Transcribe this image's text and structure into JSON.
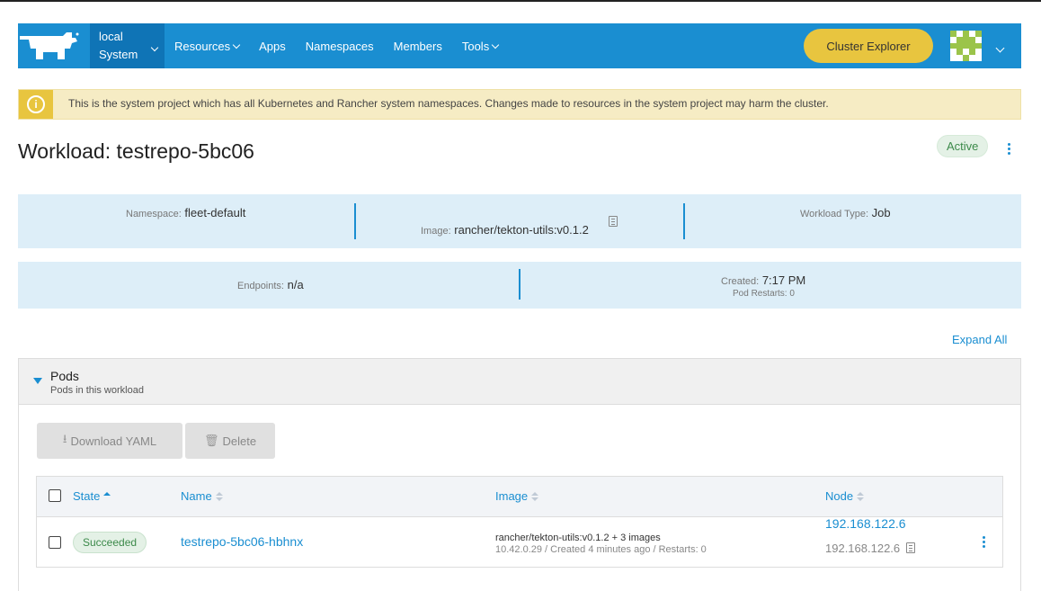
{
  "header": {
    "cluster": "local",
    "project": "System",
    "nav": [
      "Resources",
      "Apps",
      "Namespaces",
      "Members",
      "Tools"
    ],
    "cluster_explorer": "Cluster Explorer"
  },
  "banner": {
    "text": "This is the system project which has all Kubernetes and Rancher system namespaces. Changes made to resources in the system project may harm the cluster."
  },
  "workload": {
    "title": "Workload: testrepo-5bc06",
    "status": "Active"
  },
  "details": {
    "namespace_label": "Namespace:",
    "namespace": "fleet-default",
    "image_label": "Image:",
    "image": "rancher/tekton-utils:v0.1.2",
    "type_label": "Workload Type:",
    "type": "Job",
    "endpoints_label": "Endpoints:",
    "endpoints": "n/a",
    "created_label": "Created:",
    "created": "7:17 PM",
    "restarts": "Pod Restarts: 0"
  },
  "expand_all": "Expand All",
  "pods": {
    "title": "Pods",
    "subtitle": "Pods in this workload",
    "download_yaml": "Download YAML",
    "delete": "Delete",
    "columns": {
      "state": "State",
      "name": "Name",
      "image": "Image",
      "node": "Node"
    },
    "rows": [
      {
        "state": "Succeeded",
        "name": "testrepo-5bc06-hbhnx",
        "image": "rancher/tekton-utils:v0.1.2 + 3 images",
        "meta": "10.42.0.29 / Created 4 minutes ago / Restarts: 0",
        "node": "192.168.122.6",
        "node_ip": "192.168.122.6"
      }
    ]
  },
  "colors": {
    "primary": "#1a8ed1",
    "cluster_bg": "#0f74b6",
    "warning": "#e8c53f",
    "banner_bg": "#f6ecc4",
    "info_bg": "#ddeef8",
    "success": "#3c8a4a"
  },
  "icons": [
    "rancher-logo",
    "info-icon",
    "copy-icon",
    "download-icon",
    "trash-icon",
    "kebab-menu-icon",
    "sort-icon",
    "triangle-down-icon"
  ]
}
